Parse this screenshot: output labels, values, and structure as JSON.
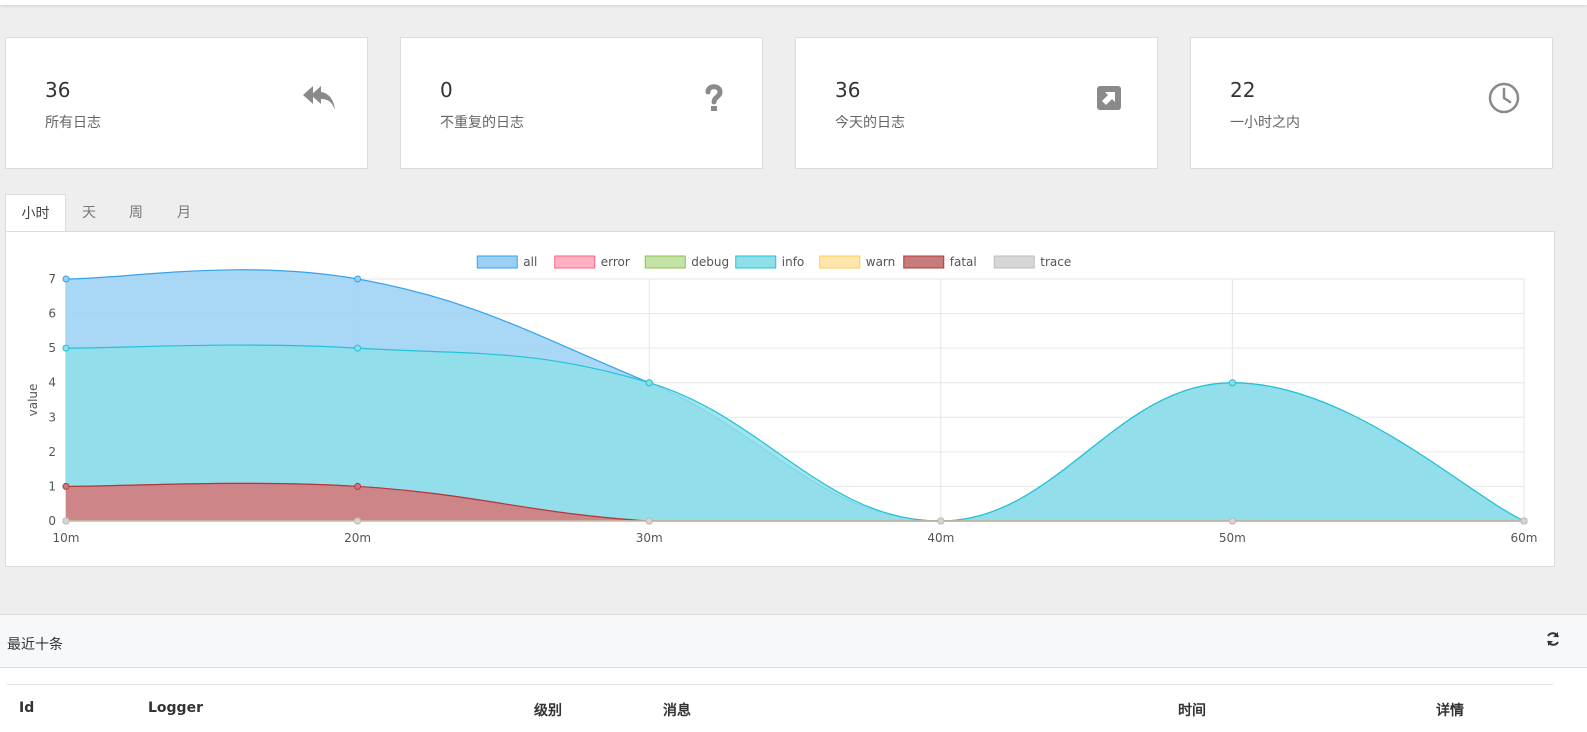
{
  "stats": [
    {
      "value": "36",
      "label": "所有日志",
      "icon": "reply-all-icon"
    },
    {
      "value": "0",
      "label": "不重复的日志",
      "icon": "question-icon"
    },
    {
      "value": "36",
      "label": "今天的日志",
      "icon": "external-link-square-icon"
    },
    {
      "value": "22",
      "label": "一小时之内",
      "icon": "clock-icon"
    }
  ],
  "tabs": [
    {
      "label": "小时",
      "active": true
    },
    {
      "label": "天",
      "active": false
    },
    {
      "label": "周",
      "active": false
    },
    {
      "label": "月",
      "active": false
    }
  ],
  "chart_data": {
    "type": "area",
    "x": [
      "10m",
      "20m",
      "30m",
      "40m",
      "50m",
      "60m"
    ],
    "ylabel": "value",
    "ylim": [
      0,
      7
    ],
    "yticks": [
      0,
      1,
      2,
      3,
      4,
      5,
      6,
      7
    ],
    "legend_position": "top-center",
    "grid": true,
    "series": [
      {
        "name": "all",
        "values": [
          7,
          7,
          4,
          0,
          4,
          0
        ],
        "stroke": "#36a2eb",
        "fill": "#9ad0f5"
      },
      {
        "name": "error",
        "values": [
          1,
          1,
          0,
          0,
          0,
          0
        ],
        "stroke": "#ff6384",
        "fill": "#ffb1c1"
      },
      {
        "name": "debug",
        "values": [
          0,
          0,
          0,
          0,
          0,
          0
        ],
        "stroke": "#8bc34a",
        "fill": "#c5e3a7"
      },
      {
        "name": "info",
        "values": [
          5,
          5,
          4,
          0,
          4,
          0
        ],
        "stroke": "#22c3d6",
        "fill": "#8fdfe9"
      },
      {
        "name": "warn",
        "values": [
          0,
          0,
          0,
          0,
          0,
          0
        ],
        "stroke": "#ffcd56",
        "fill": "#ffe6aa"
      },
      {
        "name": "fatal",
        "values": [
          1,
          1,
          0,
          0,
          0,
          0
        ],
        "stroke": "#b03a3a",
        "fill": "#c77b7b"
      },
      {
        "name": "trace",
        "values": [
          0,
          0,
          0,
          0,
          0,
          0
        ],
        "stroke": "#bdbdbd",
        "fill": "#d6d6d6"
      }
    ]
  },
  "recent": {
    "title": "最近十条",
    "columns": [
      "Id",
      "Logger",
      "级别",
      "消息",
      "时间",
      "详情"
    ]
  }
}
